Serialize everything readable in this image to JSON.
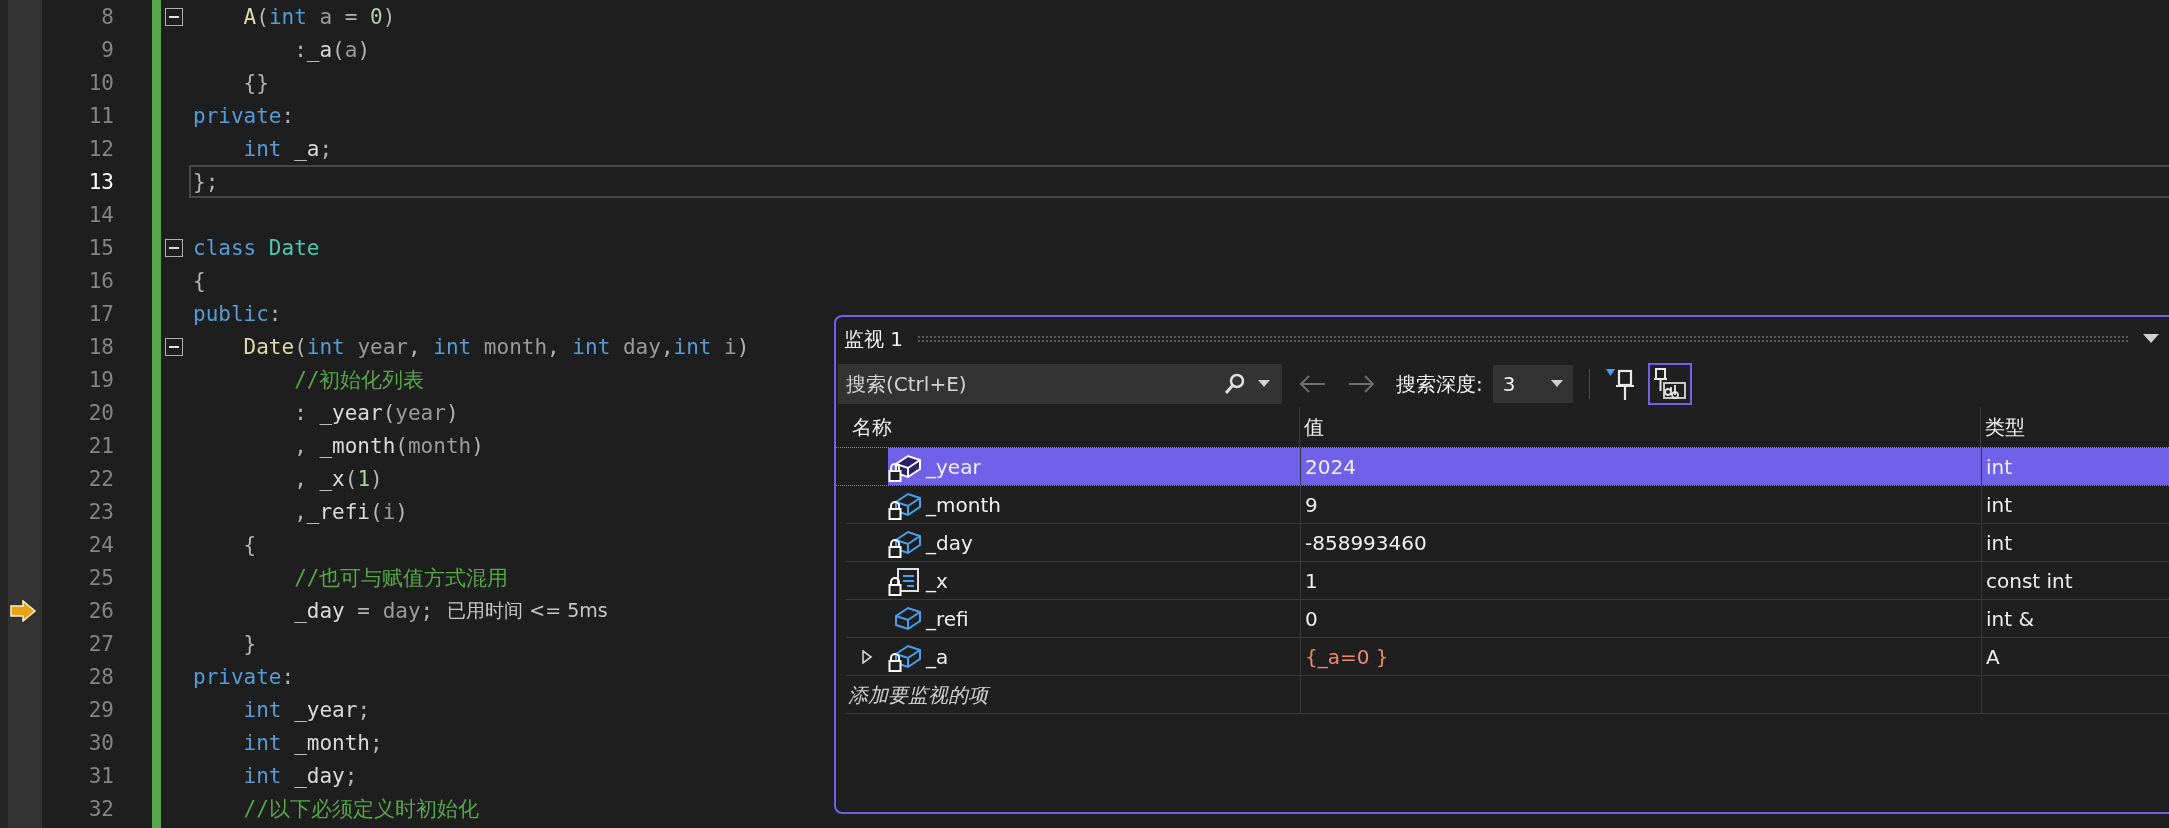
{
  "editor": {
    "lines": [
      {
        "number": "8",
        "fold": true,
        "current": false,
        "next_statement": false,
        "tokens": [
          {
            "kind": "function",
            "text": "    A"
          },
          {
            "kind": "plain",
            "text": "("
          },
          {
            "kind": "keyword",
            "text": "int"
          },
          {
            "kind": "parameter",
            "text": " a"
          },
          {
            "kind": "plain",
            "text": " = "
          },
          {
            "kind": "number",
            "text": "0"
          },
          {
            "kind": "plain",
            "text": ")"
          }
        ]
      },
      {
        "number": "9",
        "fold": false,
        "current": false,
        "next_statement": false,
        "tokens": [
          {
            "kind": "plain",
            "text": "        :"
          },
          {
            "kind": "member",
            "text": "_a"
          },
          {
            "kind": "plain",
            "text": "("
          },
          {
            "kind": "parameter",
            "text": "a"
          },
          {
            "kind": "plain",
            "text": ")"
          }
        ]
      },
      {
        "number": "10",
        "fold": false,
        "current": false,
        "next_statement": false,
        "tokens": [
          {
            "kind": "plain",
            "text": "    {}"
          }
        ]
      },
      {
        "number": "11",
        "fold": false,
        "current": false,
        "next_statement": false,
        "tokens": [
          {
            "kind": "keyword",
            "text": "private"
          },
          {
            "kind": "plain",
            "text": ":"
          }
        ]
      },
      {
        "number": "12",
        "fold": false,
        "current": false,
        "next_statement": false,
        "tokens": [
          {
            "kind": "keyword",
            "text": "    int"
          },
          {
            "kind": "member",
            "text": " _a"
          },
          {
            "kind": "plain",
            "text": ";"
          }
        ]
      },
      {
        "number": "13",
        "fold": false,
        "current": true,
        "next_statement": false,
        "tokens": [
          {
            "kind": "plain",
            "text": "};"
          }
        ]
      },
      {
        "number": "14",
        "fold": false,
        "current": false,
        "next_statement": false
      },
      {
        "number": "15",
        "fold": true,
        "current": false,
        "next_statement": false,
        "tokens": [
          {
            "kind": "keyword",
            "text": "class"
          },
          {
            "kind": "type",
            "text": " Date"
          }
        ]
      },
      {
        "number": "16",
        "fold": false,
        "current": false,
        "next_statement": false,
        "tokens": [
          {
            "kind": "plain",
            "text": "{"
          }
        ]
      },
      {
        "number": "17",
        "fold": false,
        "current": false,
        "next_statement": false,
        "tokens": [
          {
            "kind": "keyword",
            "text": "public"
          },
          {
            "kind": "plain",
            "text": ":"
          }
        ]
      },
      {
        "number": "18",
        "fold": true,
        "current": false,
        "next_statement": false,
        "tokens": [
          {
            "kind": "function",
            "text": "    Date"
          },
          {
            "kind": "plain",
            "text": "("
          },
          {
            "kind": "keyword",
            "text": "int"
          },
          {
            "kind": "parameter",
            "text": " year"
          },
          {
            "kind": "plain",
            "text": ","
          },
          {
            "kind": "keyword",
            "text": " int"
          },
          {
            "kind": "parameter",
            "text": " month"
          },
          {
            "kind": "plain",
            "text": ","
          },
          {
            "kind": "keyword",
            "text": " int"
          },
          {
            "kind": "parameter",
            "text": " day"
          },
          {
            "kind": "plain",
            "text": ","
          },
          {
            "kind": "keyword",
            "text": "int"
          },
          {
            "kind": "parameter",
            "text": " i"
          },
          {
            "kind": "plain",
            "text": ")"
          }
        ]
      },
      {
        "number": "19",
        "fold": false,
        "current": false,
        "next_statement": false,
        "tokens": [
          {
            "kind": "comment",
            "text": "        //初始化列表"
          }
        ]
      },
      {
        "number": "20",
        "fold": false,
        "current": false,
        "next_statement": false,
        "tokens": [
          {
            "kind": "plain",
            "text": "        : "
          },
          {
            "kind": "member",
            "text": "_year"
          },
          {
            "kind": "plain",
            "text": "("
          },
          {
            "kind": "parameter",
            "text": "year"
          },
          {
            "kind": "plain",
            "text": ")"
          }
        ]
      },
      {
        "number": "21",
        "fold": false,
        "current": false,
        "next_statement": false,
        "tokens": [
          {
            "kind": "plain",
            "text": "        , "
          },
          {
            "kind": "member",
            "text": "_month"
          },
          {
            "kind": "plain",
            "text": "("
          },
          {
            "kind": "parameter",
            "text": "month"
          },
          {
            "kind": "plain",
            "text": ")"
          }
        ]
      },
      {
        "number": "22",
        "fold": false,
        "current": false,
        "next_statement": false,
        "tokens": [
          {
            "kind": "plain",
            "text": "        , "
          },
          {
            "kind": "member",
            "text": "_x"
          },
          {
            "kind": "plain",
            "text": "("
          },
          {
            "kind": "number",
            "text": "1"
          },
          {
            "kind": "plain",
            "text": ")"
          }
        ]
      },
      {
        "number": "23",
        "fold": false,
        "current": false,
        "next_statement": false,
        "tokens": [
          {
            "kind": "plain",
            "text": "        ,"
          },
          {
            "kind": "member",
            "text": "_refi"
          },
          {
            "kind": "plain",
            "text": "("
          },
          {
            "kind": "parameter",
            "text": "i"
          },
          {
            "kind": "plain",
            "text": ")"
          }
        ]
      },
      {
        "number": "24",
        "fold": false,
        "current": false,
        "next_statement": false,
        "tokens": [
          {
            "kind": "plain",
            "text": "    {"
          }
        ]
      },
      {
        "number": "25",
        "fold": false,
        "current": false,
        "next_statement": false,
        "tokens": [
          {
            "kind": "comment",
            "text": "        //也可与赋值方式混用"
          }
        ]
      },
      {
        "number": "26",
        "fold": false,
        "current": false,
        "next_statement": true,
        "hint": "已用时间 <= 5ms",
        "tokens": [
          {
            "kind": "member",
            "text": "        _day"
          },
          {
            "kind": "plain",
            "text": " = "
          },
          {
            "kind": "parameter",
            "text": "day"
          },
          {
            "kind": "plain",
            "text": ";"
          }
        ]
      },
      {
        "number": "27",
        "fold": false,
        "current": false,
        "next_statement": false,
        "tokens": [
          {
            "kind": "plain",
            "text": "    }"
          }
        ]
      },
      {
        "number": "28",
        "fold": false,
        "current": false,
        "next_statement": false,
        "tokens": [
          {
            "kind": "keyword",
            "text": "private"
          },
          {
            "kind": "plain",
            "text": ":"
          }
        ]
      },
      {
        "number": "29",
        "fold": false,
        "current": false,
        "next_statement": false,
        "tokens": [
          {
            "kind": "keyword",
            "text": "    int"
          },
          {
            "kind": "member",
            "text": " _year"
          },
          {
            "kind": "plain",
            "text": ";"
          }
        ]
      },
      {
        "number": "30",
        "fold": false,
        "current": false,
        "next_statement": false,
        "tokens": [
          {
            "kind": "keyword",
            "text": "    int"
          },
          {
            "kind": "member",
            "text": " _month"
          },
          {
            "kind": "plain",
            "text": ";"
          }
        ]
      },
      {
        "number": "31",
        "fold": false,
        "current": false,
        "next_statement": false,
        "tokens": [
          {
            "kind": "keyword",
            "text": "    int"
          },
          {
            "kind": "member",
            "text": " _day"
          },
          {
            "kind": "plain",
            "text": ";"
          }
        ]
      },
      {
        "number": "32",
        "fold": false,
        "current": false,
        "next_statement": false,
        "tokens": [
          {
            "kind": "comment",
            "text": "    //以下必须定义时初始化"
          }
        ]
      }
    ]
  },
  "watch": {
    "title": "监视 1",
    "search": {
      "placeholder": "搜索(Ctrl+E)"
    },
    "search_depth": {
      "label": "搜索深度:",
      "value": "3"
    },
    "columns": [
      "名称",
      "值",
      "类型"
    ],
    "rows": [
      {
        "name": "_year",
        "value": "2024",
        "type": "int",
        "kind": "private-field",
        "selected": true,
        "changed": false
      },
      {
        "name": "_month",
        "value": "9",
        "type": "int",
        "kind": "private-field",
        "selected": false,
        "changed": false
      },
      {
        "name": "_day",
        "value": "-858993460",
        "type": "int",
        "kind": "private-field",
        "selected": false,
        "changed": false
      },
      {
        "name": "_x",
        "value": "1",
        "type": "const int",
        "kind": "private-constant",
        "selected": false,
        "changed": false
      },
      {
        "name": "_refi",
        "value": "0",
        "type": "int &",
        "kind": "field",
        "selected": false,
        "changed": false
      },
      {
        "name": "_a",
        "value": "{_a=0 }",
        "type": "A",
        "kind": "private-field",
        "selected": false,
        "changed": true,
        "expanded": false
      }
    ],
    "add_item_placeholder": "添加要监视的项"
  }
}
